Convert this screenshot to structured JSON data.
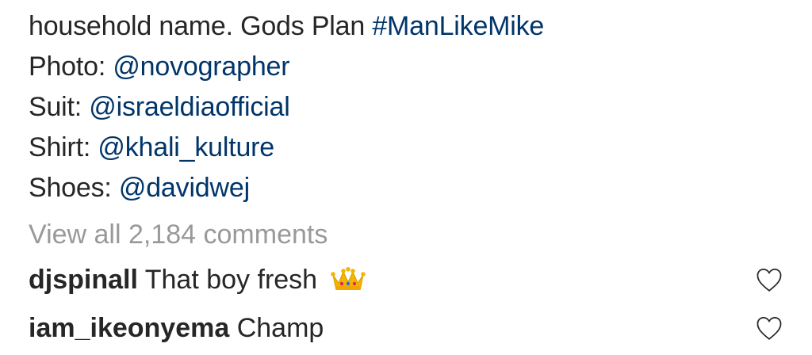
{
  "caption": {
    "line1_text": "household name. Gods Plan ",
    "line1_hashtag": "#ManLikeMike",
    "credits": [
      {
        "label": "Photo: ",
        "handle": "@novographer"
      },
      {
        "label": "Suit: ",
        "handle": "@israeldiaofficial"
      },
      {
        "label": "Shirt: ",
        "handle": "@khali_kulture"
      },
      {
        "label": "Shoes: ",
        "handle": "@davidwej"
      }
    ]
  },
  "view_all_comments": "View all 2,184 comments",
  "comments": [
    {
      "username": "djspinall",
      "text": " That boy fresh",
      "emoji": "crown-icon"
    },
    {
      "username": "iam_ikeonyema",
      "text": " Champ",
      "emoji": ""
    }
  ],
  "icons": {
    "like": "heart-outline-icon"
  },
  "colors": {
    "text": "#262626",
    "link": "#003569",
    "muted": "#999999",
    "crown": "#f5b400"
  }
}
